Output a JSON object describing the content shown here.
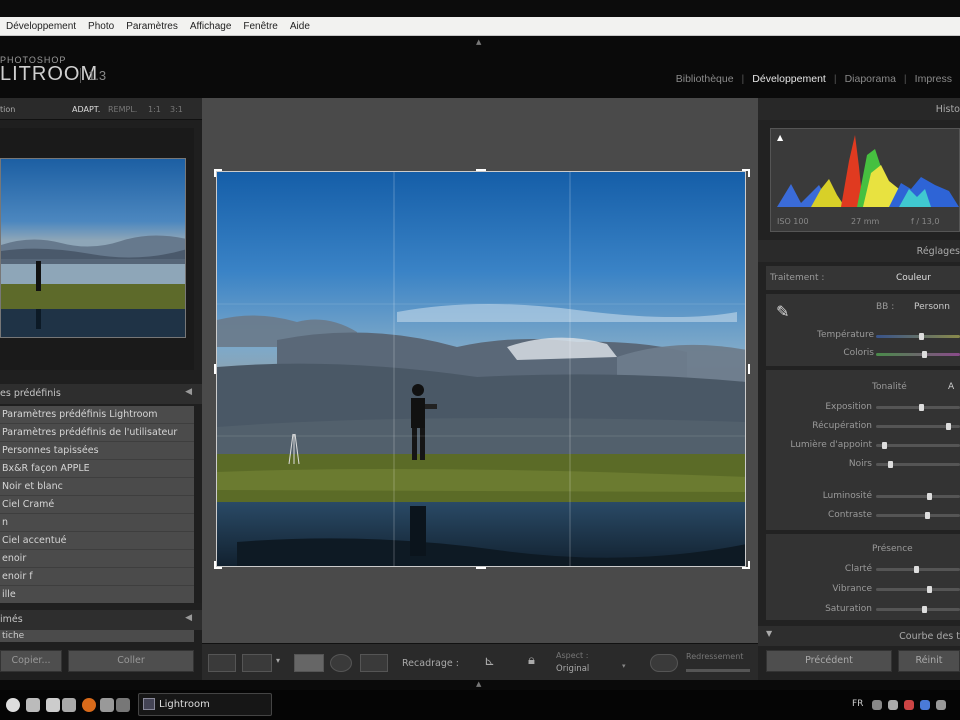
{
  "menubar": {
    "items": [
      "Développement",
      "Photo",
      "Paramètres",
      "Affichage",
      "Fenêtre",
      "Aide"
    ]
  },
  "identity": {
    "logo_small": "PHOTOSHOP",
    "logo_big": "LITROOM",
    "version": "1.3"
  },
  "modules": {
    "items": [
      "Bibliothèque",
      "Développement",
      "Diaporama",
      "Impress"
    ],
    "active": "Développement"
  },
  "navigator": {
    "title": "tion",
    "options": [
      "ADAPT.",
      "REMPL.",
      "1:1",
      "3:1"
    ]
  },
  "presets": {
    "title": "es prédéfinis",
    "items": [
      "Paramètres prédéfinis Lightroom",
      "Paramètres prédéfinis de l'utilisateur",
      "Personnes tapissées",
      "Bx&R façon APPLE",
      "Noir et blanc",
      "Ciel Cramé",
      "n",
      "Ciel accentué",
      "enoir",
      "enoir f",
      "ille"
    ]
  },
  "snapshots": {
    "title": "imés",
    "item": "tiche"
  },
  "left_buttons": {
    "copy": "Copier...",
    "paste": "Coller"
  },
  "toolbar": {
    "crop_label": "Recadrage :",
    "aspect_label": "Aspect :",
    "aspect_value": "Original",
    "straighten_label": "Redressement"
  },
  "histogram": {
    "title": "Histo",
    "info": [
      "ISO 100",
      "27 mm",
      "f / 13,0"
    ]
  },
  "basic": {
    "title": "Réglages",
    "treatment_label": "Traitement :",
    "treatment_value": "Couleur",
    "wb_label": "BB :",
    "wb_value": "Personn",
    "temp_label": "Température",
    "temp_value": 0.54,
    "tint_label": "Coloris",
    "tint_value": 0.58,
    "tone_label": "Tonalité",
    "tone_auto": "A",
    "exposure_label": "Exposition",
    "exposure_value": 0.55,
    "recovery_label": "Récupération",
    "recovery_value": 0.88,
    "fill_label": "Lumière d'appoint",
    "fill_value": 0.08,
    "blacks_label": "Noirs",
    "blacks_value": 0.15,
    "brightness_label": "Luminosité",
    "brightness_value": 0.65,
    "contrast_label": "Contraste",
    "contrast_value": 0.62,
    "presence_label": "Présence",
    "clarity_label": "Clarté",
    "clarity_value": 0.48,
    "vibrance_label": "Vibrance",
    "vibrance_value": 0.65,
    "saturation_label": "Saturation",
    "saturation_value": 0.58
  },
  "curves": {
    "title": "Courbe des t"
  },
  "right_buttons": {
    "previous": "Précédent",
    "reset": "Réinit"
  },
  "taskbar": {
    "app": "Lightroom",
    "lang": "FR"
  }
}
